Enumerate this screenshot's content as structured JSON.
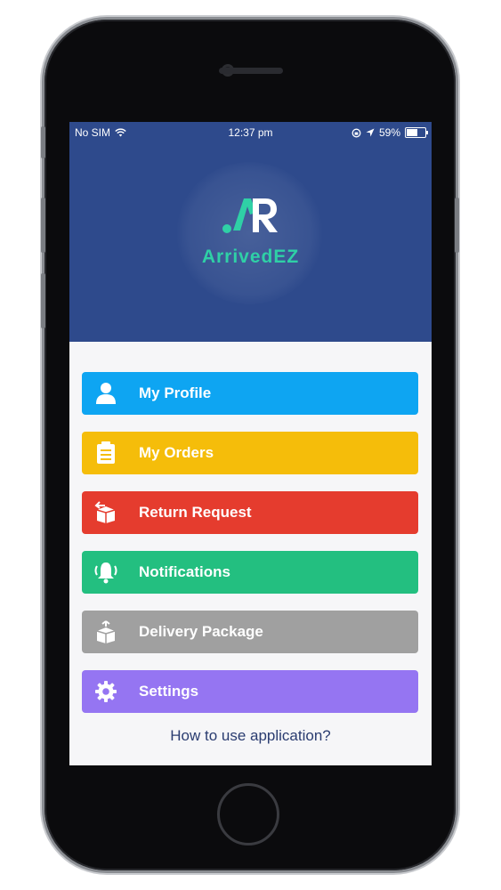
{
  "status_bar": {
    "carrier": "No SIM",
    "time": "12:37 pm",
    "battery": "59%",
    "battery_level": 0.59
  },
  "brand": {
    "name": "ArrivedEZ",
    "logo_letters": "AR"
  },
  "menu": [
    {
      "label": "My Profile",
      "icon": "person-icon",
      "color": "#0ea5f2"
    },
    {
      "label": "My Orders",
      "icon": "clipboard-icon",
      "color": "#f5bd0a"
    },
    {
      "label": "Return Request",
      "icon": "return-box-icon",
      "color": "#e53c2e"
    },
    {
      "label": "Notifications",
      "icon": "bell-ringing-icon",
      "color": "#23bf80"
    },
    {
      "label": "Delivery Package",
      "icon": "package-icon",
      "color": "#a0a0a0"
    },
    {
      "label": "Settings",
      "icon": "gear-icon",
      "color": "#9575f2"
    }
  ],
  "help_link": "How to use application?",
  "colors": {
    "header": "#2e4a8c",
    "brand_accent": "#2fd0a6",
    "background": "#f6f6f8"
  }
}
